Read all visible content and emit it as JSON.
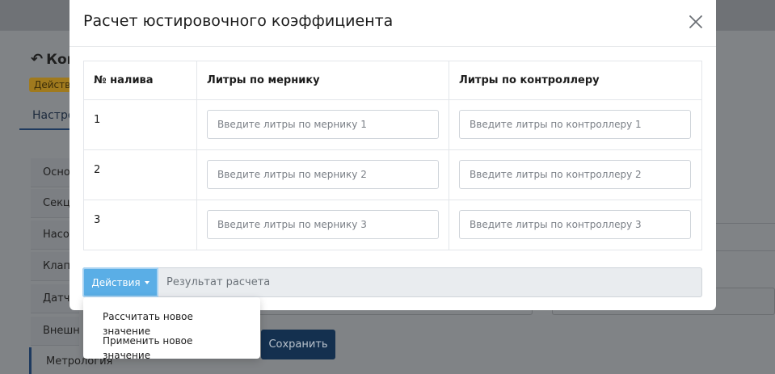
{
  "background": {
    "title": "Ком",
    "badge": "Действ",
    "tab": "Настро",
    "sidebar": [
      "Осно",
      "Секц",
      "Насо",
      "Клап",
      "Датч",
      "Внешн"
    ],
    "sidebar_active": "Метрология",
    "save_label": "Сохранить"
  },
  "modal": {
    "title": "Расчет юстировочного коэффициента",
    "columns": [
      "№ налива",
      "Литры по мернику",
      "Литры по контроллеру"
    ],
    "rows": [
      {
        "num": "1",
        "meter_placeholder": "Введите литры по мернику 1",
        "controller_placeholder": "Введите литры по контроллеру 1"
      },
      {
        "num": "2",
        "meter_placeholder": "Введите литры по мернику 2",
        "controller_placeholder": "Введите литры по контроллеру 2"
      },
      {
        "num": "3",
        "meter_placeholder": "Введите литры по мернику 3",
        "controller_placeholder": "Введите литры по контроллеру 3"
      }
    ],
    "actions_label": "Действия",
    "result_placeholder": "Результат расчета"
  },
  "dropdown": {
    "items": [
      "Рассчитать новое значение",
      "Применить новое значение"
    ]
  },
  "colors": {
    "accent": "#5aaee6",
    "overlay": "#808386",
    "save_button": "#14304f"
  }
}
